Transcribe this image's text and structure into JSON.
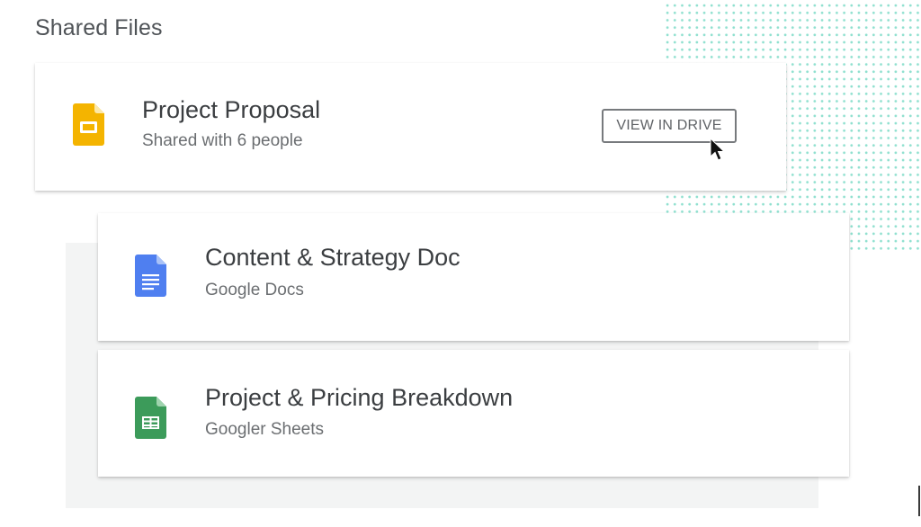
{
  "heading": "Shared Files",
  "files": [
    {
      "title": "Project Proposal",
      "subtitle": "Shared with 6 people",
      "icon": "google-slides-icon",
      "icon_color": "#f4b400",
      "action_label": "VIEW IN DRIVE"
    },
    {
      "title": "Content & Strategy Doc",
      "subtitle": "Google Docs",
      "icon": "google-docs-icon",
      "icon_color": "#4285f4"
    },
    {
      "title": "Project & Pricing Breakdown",
      "subtitle": "Googler Sheets",
      "icon": "google-sheets-icon",
      "icon_color": "#0f9d58"
    }
  ],
  "colors": {
    "dot_pattern": "#8fe0cf",
    "panel": "#f3f4f4",
    "title_text": "#3b3e41",
    "subtitle_text": "#6b6e71"
  },
  "cursor": "mouse-pointer-icon"
}
